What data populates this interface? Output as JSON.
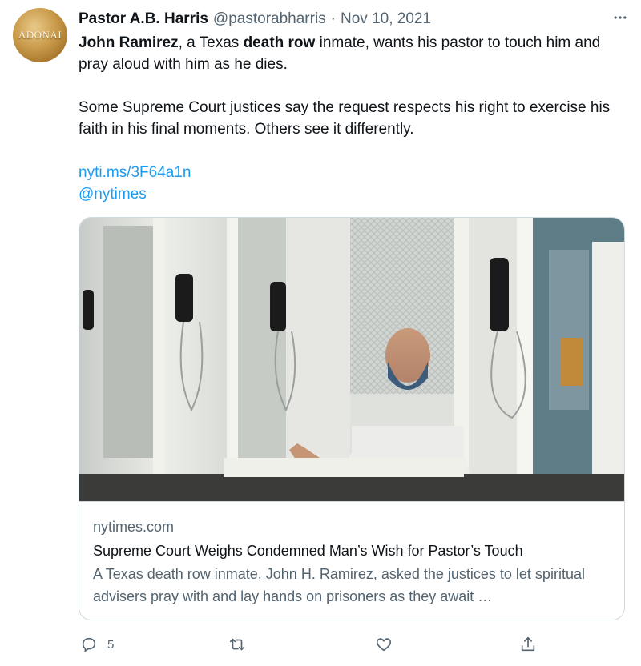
{
  "author": {
    "name": "Pastor A.B. Harris",
    "handle": "@pastorabharris",
    "separator": "·",
    "date": "Nov 10, 2021",
    "avatar_text": "ADONAI",
    "more_icon": "ellipsis-icon"
  },
  "tweet": {
    "p1_a": "John Ramirez",
    "p1_b": ", a Texas ",
    "p1_c": "death row",
    "p1_d": " inmate, wants his pastor to touch him and pray aloud with him as he dies.",
    "p2": "Some Supreme Court justices say the request respects his right to exercise his faith in his final moments. Others see it differently.",
    "link": "nyti.ms/3F64a1n",
    "mention": "@nytimes"
  },
  "card": {
    "domain": "nytimes.com",
    "title": "Supreme Court Weighs Condemned Man’s Wish for Pastor’s Touch",
    "description": "A Texas death row inmate, John H. Ramirez, asked the justices to let spiritual advisers pray with and lay hands on prisoners as they await …"
  },
  "actions": {
    "reply_count": "5",
    "reply_icon": "reply-icon",
    "retweet_icon": "retweet-icon",
    "like_icon": "heart-icon",
    "share_icon": "share-icon"
  },
  "colors": {
    "link": "#1d9bf0",
    "secondary_text": "#536471",
    "border": "#cfd9de"
  }
}
